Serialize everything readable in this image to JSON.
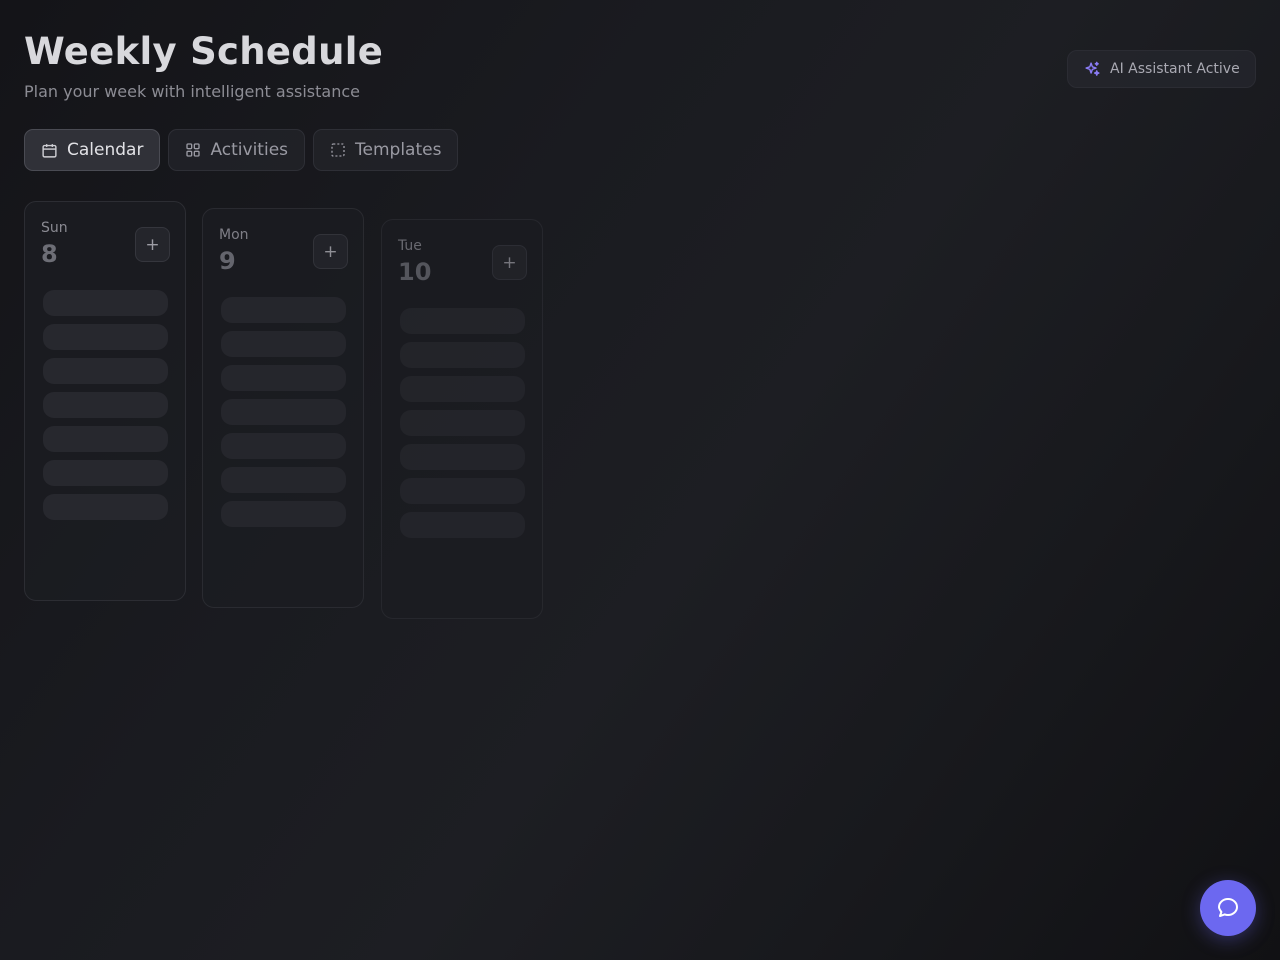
{
  "header": {
    "title": "Weekly Schedule",
    "subtitle": "Plan your week with intelligent assistance"
  },
  "ai_badge": {
    "label": "AI Assistant Active",
    "icon": "sparkles-icon",
    "accent": "#7b6cf0"
  },
  "tabs": [
    {
      "label": "Calendar",
      "icon": "calendar-icon",
      "active": true
    },
    {
      "label": "Activities",
      "icon": "grid-icon",
      "active": false
    },
    {
      "label": "Templates",
      "icon": "dashed-square-icon",
      "active": false
    }
  ],
  "days": [
    {
      "name": "Sun",
      "number": "8",
      "add_label": "+"
    },
    {
      "name": "Mon",
      "number": "9",
      "add_label": "+"
    },
    {
      "name": "Tue",
      "number": "10",
      "add_label": "+"
    }
  ],
  "chat_button": {
    "icon": "chat-bubble-icon",
    "color": "#6c68f0"
  }
}
